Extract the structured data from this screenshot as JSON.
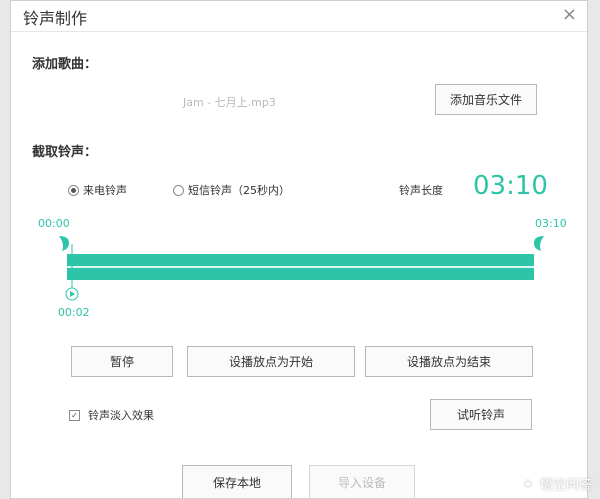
{
  "dialog": {
    "title": "铃声制作",
    "close": "×"
  },
  "add_song": {
    "label": "添加歌曲：",
    "filename": "Jam - 七月上.mp3",
    "add_button": "添加音乐文件"
  },
  "clip": {
    "label": "截取铃声：",
    "radio_call": "来电铃声",
    "radio_sms": "短信铃声（25秒内）",
    "selected": "call",
    "length_label": "铃声长度",
    "length_value": "03:10",
    "start_time": "00:00",
    "end_time": "03:10",
    "playhead_time": "00:02",
    "playhead_fraction": 0.0105
  },
  "controls": {
    "pause": "暂停",
    "set_start": "设播放点为开始",
    "set_end": "设播放点为结束",
    "fade": "铃声淡入效果",
    "fade_checked": true,
    "preview": "试听铃声"
  },
  "footer": {
    "save_local": "保存本地",
    "import_device": "导入设备"
  },
  "watermark": {
    "text": "悟空问答",
    "icon": "wukong-logo-icon"
  },
  "colors": {
    "accent": "#2ec4a8",
    "track_inner": "#dff7f1"
  }
}
